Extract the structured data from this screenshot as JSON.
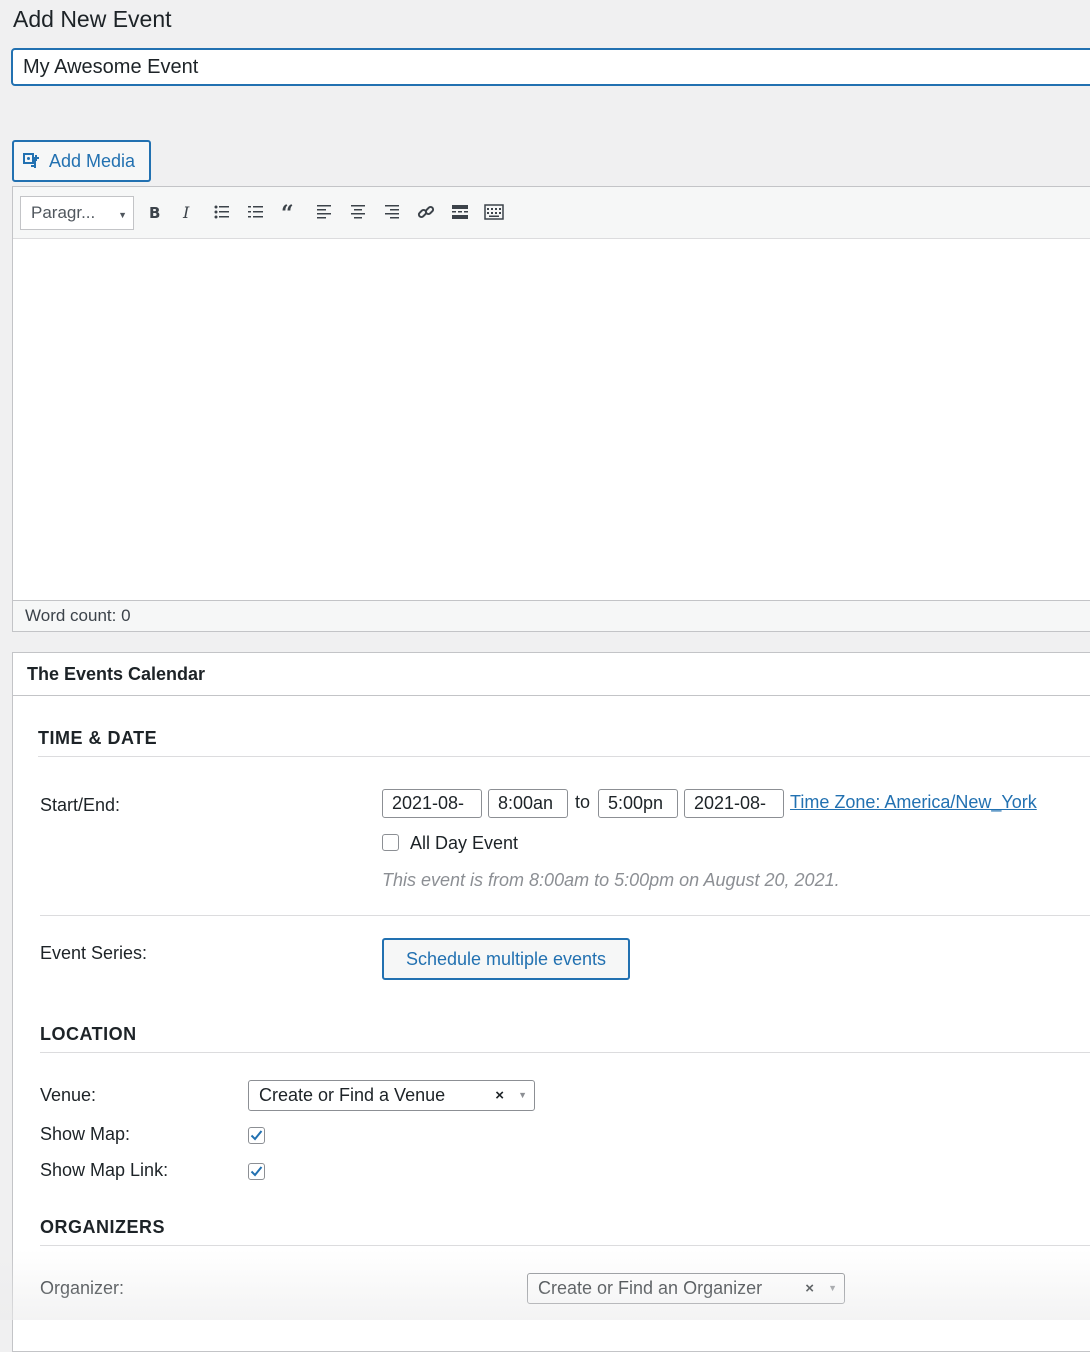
{
  "page": {
    "title": "Add New Event"
  },
  "title_input": {
    "value": "My Awesome Event"
  },
  "add_media": {
    "label": "Add Media",
    "icon": "add-media-icon"
  },
  "editor": {
    "format_select": "Paragr...",
    "toolbar_icons": [
      "bold-icon",
      "italic-icon",
      "bulleted-list-icon",
      "numbered-list-icon",
      "blockquote-icon",
      "align-left-icon",
      "align-center-icon",
      "align-right-icon",
      "link-icon",
      "read-more-icon",
      "toolbar-toggle-icon"
    ],
    "word_count": "Word count: 0"
  },
  "metabox": {
    "title": "The Events Calendar",
    "time_date": {
      "heading": "TIME & DATE",
      "start_end_label": "Start/End:",
      "start_date": "2021-08-",
      "start_time": "8:00an",
      "to": "to",
      "end_time": "5:00pn",
      "end_date": "2021-08-",
      "timezone_link": "Time Zone: America/New_York",
      "all_day_label": "All Day Event",
      "all_day_checked": false,
      "summary": "This event is from 8:00am to 5:00pm on August 20, 2021."
    },
    "series": {
      "label": "Event Series:",
      "button": "Schedule multiple events"
    },
    "location": {
      "heading": "LOCATION",
      "venue_label": "Venue:",
      "venue_select": "Create or Find a Venue",
      "show_map_label": "Show Map:",
      "show_map_checked": true,
      "show_map_link_label": "Show Map Link:",
      "show_map_link_checked": true
    },
    "organizers": {
      "heading": "ORGANIZERS",
      "organizer_label": "Organizer:",
      "organizer_select": "Create or Find an Organizer"
    }
  },
  "colors": {
    "accent": "#2271b1",
    "text": "#1d2327",
    "muted": "#8c8f94",
    "background": "#f0f0f1"
  }
}
